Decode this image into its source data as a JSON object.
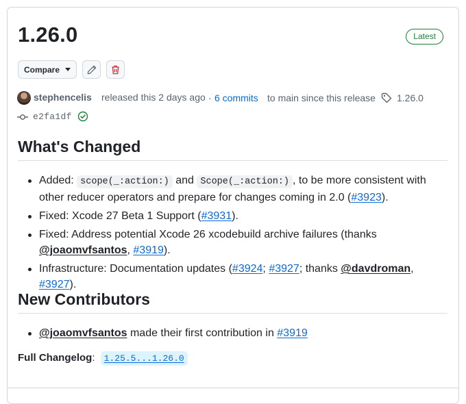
{
  "release": {
    "title": "1.26.0",
    "badge": "Latest"
  },
  "actions": {
    "compare_label": "Compare",
    "edit_icon": "pencil-icon",
    "delete_icon": "trash-icon"
  },
  "meta": {
    "author": "stephencelis",
    "released_text": "released this 2 days ago",
    "separator": "·",
    "commits_link": "6 commits",
    "commits_rest": "to main since this release",
    "tag": "1.26.0",
    "commit_sha": "e2fa1df"
  },
  "whats_changed": {
    "heading": "What's Changed",
    "items": [
      {
        "prefix": "Added: ",
        "code1": "scope(_:action:)",
        "mid": " and ",
        "code2": "Scope(_:action:)",
        "text": ", to be more consistent with other reducer operators and prepare for changes coming in 2.0 (",
        "link": "#3923",
        "suffix": ")."
      },
      {
        "prefix": "Fixed: Xcode 27 Beta 1 Support (",
        "link": "#3931",
        "suffix": ")."
      },
      {
        "prefix": "Fixed: Address potential Xcode 26 xcodebuild archive failures (thanks ",
        "mention": "@joaomvfsantos",
        "sep": ", ",
        "link": "#3919",
        "suffix": ")."
      },
      {
        "prefix": "Infrastructure: Documentation updates (",
        "link1": "#3924",
        "sep1": "; ",
        "link2": "#3927",
        "text": "; thanks ",
        "mention": "@davdroman",
        "sep2": ", ",
        "link3": "#3927",
        "suffix": ")."
      }
    ]
  },
  "new_contributors": {
    "heading": "New Contributors",
    "items": [
      {
        "mention": "@joaomvfsantos",
        "text": " made their first contribution in ",
        "link": "#3919"
      }
    ]
  },
  "changelog": {
    "label": "Full Changelog",
    "colon": ":",
    "range": "1.25.5...1.26.0"
  },
  "colors": {
    "link": "#0969da",
    "latest_badge": "#1a7f37",
    "delete_icon": "#cf222e",
    "verified": "#1a7f37"
  }
}
